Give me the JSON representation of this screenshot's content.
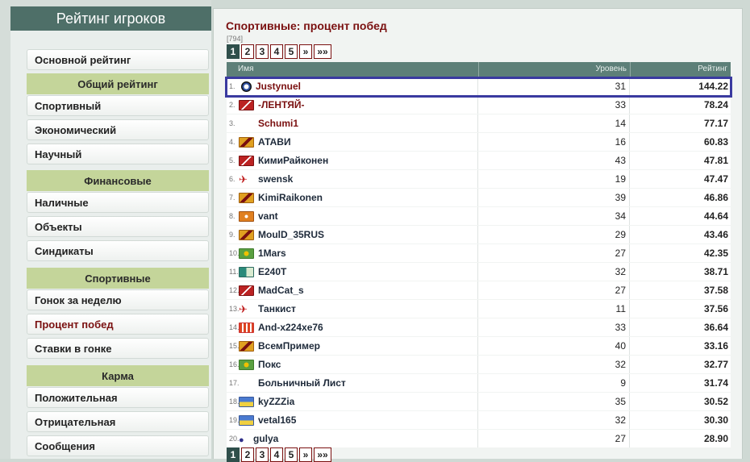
{
  "sidebar": {
    "title": "Рейтинг игроков",
    "items": [
      {
        "type": "item",
        "label": "Основной рейтинг"
      },
      {
        "type": "header",
        "label": "Общий рейтинг"
      },
      {
        "type": "item",
        "label": "Спортивный"
      },
      {
        "type": "item",
        "label": "Экономический"
      },
      {
        "type": "item",
        "label": "Научный"
      },
      {
        "type": "header",
        "label": "Финансовые"
      },
      {
        "type": "item",
        "label": "Наличные"
      },
      {
        "type": "item",
        "label": "Объекты"
      },
      {
        "type": "item",
        "label": "Синдикаты"
      },
      {
        "type": "header",
        "label": "Спортивные"
      },
      {
        "type": "item",
        "label": "Гонок за неделю"
      },
      {
        "type": "item",
        "label": "Процент побед",
        "active": true
      },
      {
        "type": "item",
        "label": "Ставки в гонке"
      },
      {
        "type": "header",
        "label": "Карма"
      },
      {
        "type": "item",
        "label": "Положительная"
      },
      {
        "type": "item",
        "label": "Отрицательная"
      },
      {
        "type": "item",
        "label": "Сообщения"
      }
    ]
  },
  "main": {
    "title": "Спортивные: процент побед",
    "total": "[794]",
    "pager": [
      "1",
      "2",
      "3",
      "4",
      "5",
      "»",
      "»»"
    ],
    "current_page": "1",
    "columns": {
      "name": "Имя",
      "level": "Уровень",
      "rating": "Рейтинг"
    },
    "rows": [
      {
        "rank": "1.",
        "name": "Justynuel",
        "level": "31",
        "rating": "144.22",
        "icon": "bmw-logo-icon",
        "style": "f-bmw",
        "red": true
      },
      {
        "rank": "2.",
        "name": "-ЛЕНТЯЙ-",
        "level": "33",
        "rating": "78.24",
        "icon": "team-flag-icon",
        "style": "f-red",
        "red": true
      },
      {
        "rank": "3.",
        "name": "Schumi1",
        "level": "14",
        "rating": "77.17",
        "icon": "none",
        "style": "f-none",
        "red": true
      },
      {
        "rank": "4.",
        "name": "АТАВИ",
        "level": "16",
        "rating": "60.83",
        "icon": "team-flag-icon",
        "style": "f-gold"
      },
      {
        "rank": "5.",
        "name": "КимиРайконен",
        "level": "43",
        "rating": "47.81",
        "icon": "team-flag-icon",
        "style": "f-red"
      },
      {
        "rank": "6.",
        "name": "swensk",
        "level": "19",
        "rating": "47.47",
        "icon": "bird-icon",
        "style": "f-bird"
      },
      {
        "rank": "7.",
        "name": "KimiRaikonen",
        "level": "39",
        "rating": "46.86",
        "icon": "team-flag-icon",
        "style": "f-gold"
      },
      {
        "rank": "8.",
        "name": "vant",
        "level": "34",
        "rating": "44.64",
        "icon": "team-flag-icon",
        "style": "f-orange"
      },
      {
        "rank": "9.",
        "name": "MoulD_35RUS",
        "level": "29",
        "rating": "43.46",
        "icon": "team-flag-icon",
        "style": "f-gold"
      },
      {
        "rank": "10.",
        "name": "1Mars",
        "level": "27",
        "rating": "42.35",
        "icon": "team-flag-icon",
        "style": "f-green"
      },
      {
        "rank": "11.",
        "name": "E240T",
        "level": "32",
        "rating": "38.71",
        "icon": "team-flag-icon",
        "style": "f-teal"
      },
      {
        "rank": "12.",
        "name": "MadCat_s",
        "level": "27",
        "rating": "37.58",
        "icon": "team-flag-icon",
        "style": "f-red"
      },
      {
        "rank": "13.",
        "name": "Танкист",
        "level": "11",
        "rating": "37.56",
        "icon": "bird-icon",
        "style": "f-bird"
      },
      {
        "rank": "14.",
        "name": "And-x224xe76",
        "level": "33",
        "rating": "36.64",
        "icon": "team-flag-icon",
        "style": "f-rings"
      },
      {
        "rank": "15.",
        "name": "ВсемПример",
        "level": "40",
        "rating": "33.16",
        "icon": "team-flag-icon",
        "style": "f-gold"
      },
      {
        "rank": "16.",
        "name": "Покс",
        "level": "32",
        "rating": "32.77",
        "icon": "team-flag-icon",
        "style": "f-green"
      },
      {
        "rank": "17.",
        "name": "Больничный Лист",
        "level": "9",
        "rating": "31.74",
        "icon": "none",
        "style": "f-none"
      },
      {
        "rank": "18.",
        "name": "kyZZZia",
        "level": "35",
        "rating": "30.52",
        "icon": "team-flag-icon",
        "style": "f-ua"
      },
      {
        "rank": "19.",
        "name": "vetal165",
        "level": "32",
        "rating": "30.30",
        "icon": "team-flag-icon",
        "style": "f-ua"
      },
      {
        "rank": "20.",
        "name": "gulya",
        "level": "27",
        "rating": "28.90",
        "icon": "pin-icon",
        "style": "f-pin"
      }
    ]
  }
}
